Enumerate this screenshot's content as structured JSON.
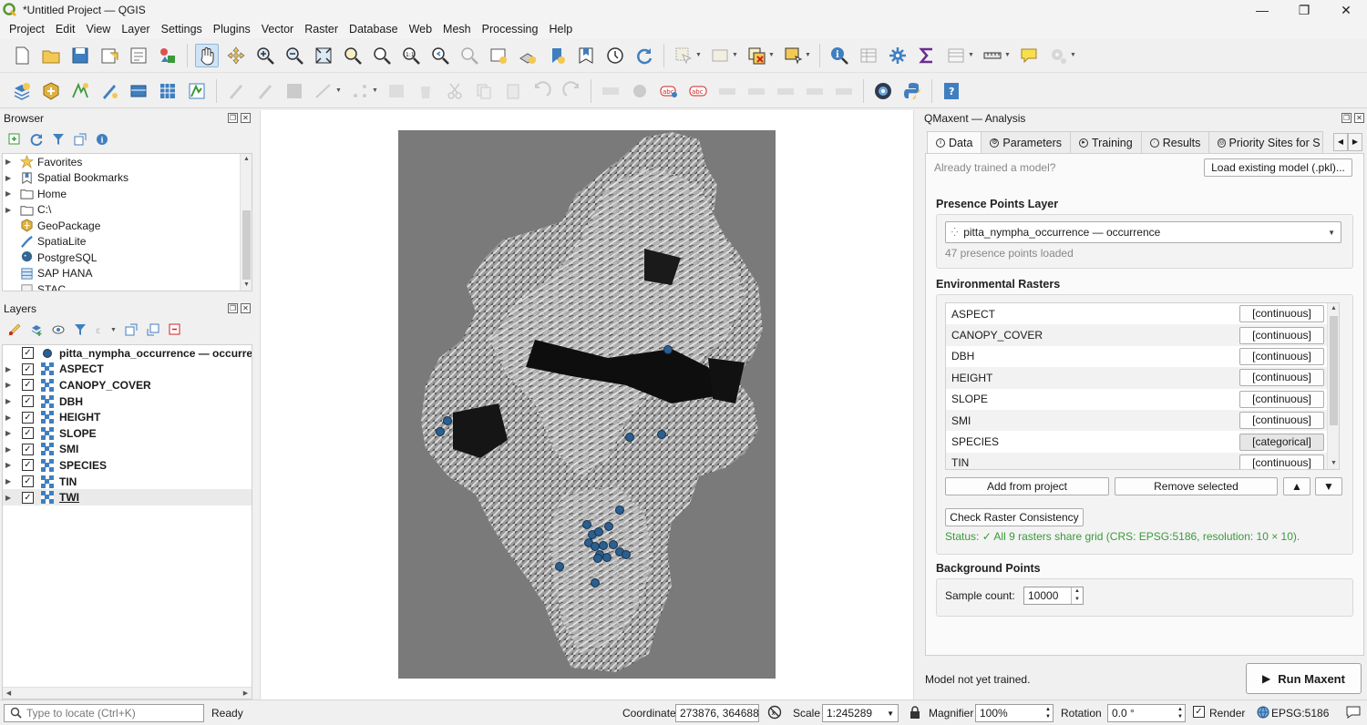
{
  "window": {
    "title": "*Untitled Project — QGIS",
    "minimize": "—",
    "maximize": "❐",
    "close": "✕"
  },
  "menu": [
    "Project",
    "Edit",
    "View",
    "Layer",
    "Settings",
    "Plugins",
    "Vector",
    "Raster",
    "Database",
    "Web",
    "Mesh",
    "Processing",
    "Help"
  ],
  "browser": {
    "title": "Browser",
    "items": [
      {
        "label": "Favorites",
        "icon": "star-icon"
      },
      {
        "label": "Spatial Bookmarks",
        "icon": "bookmark-icon"
      },
      {
        "label": "Home",
        "icon": "folder-icon"
      },
      {
        "label": "C:\\",
        "icon": "drive-icon"
      },
      {
        "label": "GeoPackage",
        "icon": "geopackage-icon"
      },
      {
        "label": "SpatiaLite",
        "icon": "spatialite-icon"
      },
      {
        "label": "PostgreSQL",
        "icon": "postgresql-icon"
      },
      {
        "label": "SAP HANA",
        "icon": "database-icon"
      },
      {
        "label": "STAC",
        "icon": "stac-icon"
      }
    ]
  },
  "layers": {
    "title": "Layers",
    "items": [
      {
        "name": "pitta_nympha_occurrence — occurrence",
        "type": "point"
      },
      {
        "name": "ASPECT",
        "type": "raster"
      },
      {
        "name": "CANOPY_COVER",
        "type": "raster"
      },
      {
        "name": "DBH",
        "type": "raster"
      },
      {
        "name": "HEIGHT",
        "type": "raster"
      },
      {
        "name": "SLOPE",
        "type": "raster"
      },
      {
        "name": "SMI",
        "type": "raster"
      },
      {
        "name": "SPECIES",
        "type": "raster"
      },
      {
        "name": "TIN",
        "type": "raster"
      },
      {
        "name": "TWI",
        "type": "raster"
      }
    ]
  },
  "panel": {
    "title": "QMaxent — Analysis",
    "tabs": [
      "Data",
      "Parameters",
      "Training",
      "Results",
      "Priority Sites for S"
    ],
    "already_trained": "Already trained a model?",
    "load_model": "Load existing model (.pkl)...",
    "presence_title": "Presence Points Layer",
    "presence_layer": "pitta_nympha_occurrence — occurrence",
    "presence_count": "47 presence points loaded",
    "env_title": "Environmental Rasters",
    "rasters": [
      {
        "name": "ASPECT",
        "type": "[continuous]"
      },
      {
        "name": "CANOPY_COVER",
        "type": "[continuous]"
      },
      {
        "name": "DBH",
        "type": "[continuous]"
      },
      {
        "name": "HEIGHT",
        "type": "[continuous]"
      },
      {
        "name": "SLOPE",
        "type": "[continuous]"
      },
      {
        "name": "SMI",
        "type": "[continuous]"
      },
      {
        "name": "SPECIES",
        "type": "[categorical]"
      },
      {
        "name": "TIN",
        "type": "[continuous]"
      }
    ],
    "add_from_project": "Add from project",
    "remove_selected": "Remove selected",
    "move_up": "▲",
    "move_down": "▼",
    "check_consistency": "Check Raster Consistency",
    "status": "Status: ✓ All 9 rasters share grid (CRS: EPSG:5186, resolution: 10 × 10).",
    "background_title": "Background Points",
    "sample_label": "Sample count:",
    "sample_value": "10000",
    "model_status": "Model not yet trained.",
    "run_label": "Run Maxent"
  },
  "statusbar": {
    "locate_placeholder": "Type to locate (Ctrl+K)",
    "ready": "Ready",
    "coordinate_label": "Coordinate",
    "coordinate_value": "273876, 364688",
    "scale_label": "Scale",
    "scale_value": "1:245289",
    "magnifier_label": "Magnifier",
    "magnifier_value": "100%",
    "rotation_label": "Rotation",
    "rotation_value": "0.0 °",
    "render_label": "Render",
    "crs": "EPSG:5186"
  },
  "colors": {
    "accent": "#2e6ea6",
    "status_ok": "#3a9a3a",
    "point_fill": "#2b5f8f"
  }
}
